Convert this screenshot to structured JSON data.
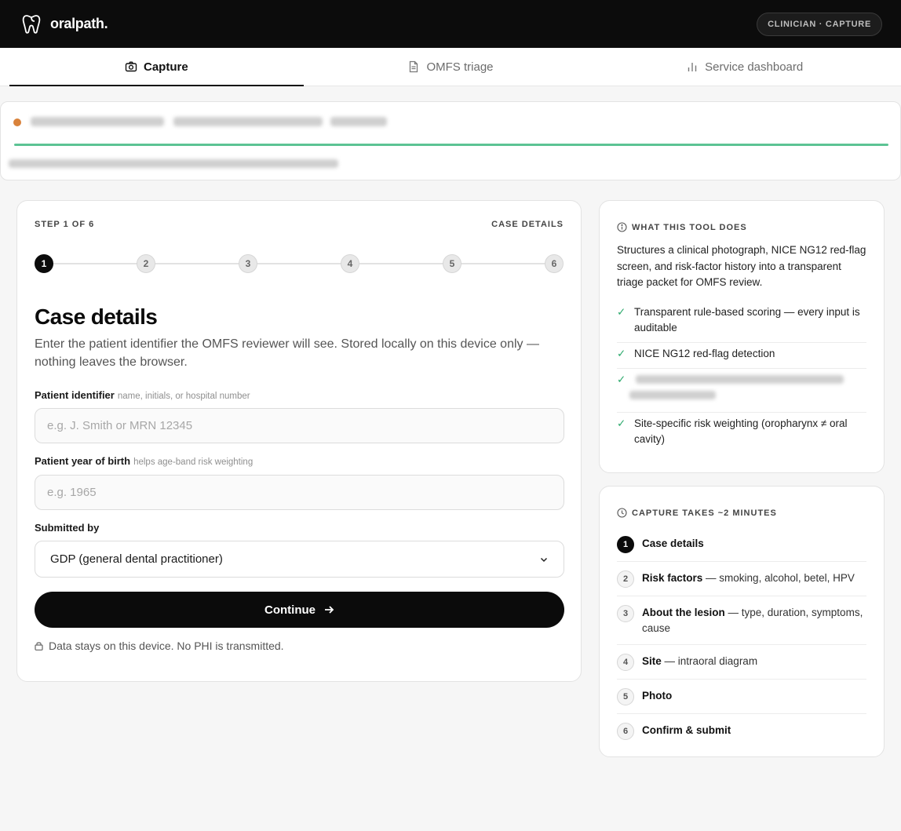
{
  "header": {
    "brand": "oralpath.",
    "mode_pill": "CLINICIAN · CAPTURE"
  },
  "tabs": [
    {
      "label": "Capture",
      "icon": "camera-icon",
      "active": true
    },
    {
      "label": "OMFS triage",
      "icon": "document-icon",
      "active": false
    },
    {
      "label": "Service dashboard",
      "icon": "bar-chart-icon",
      "active": false
    }
  ],
  "form": {
    "step_label": "STEP 1 OF 6",
    "section_label": "CASE DETAILS",
    "steps": [
      "1",
      "2",
      "3",
      "4",
      "5",
      "6"
    ],
    "active_step": 1,
    "title": "Case details",
    "lede": "Enter the patient identifier the OMFS reviewer will see. Stored locally on this device only — nothing leaves the browser.",
    "patient_id": {
      "label": "Patient identifier",
      "hint": "name, initials, or hospital number",
      "placeholder": "e.g. J. Smith or MRN 12345",
      "value": ""
    },
    "birth_year": {
      "label": "Patient year of birth",
      "hint": "helps age-band risk weighting",
      "placeholder": "e.g. 1965",
      "value": ""
    },
    "submitted_by": {
      "label": "Submitted by",
      "value": "GDP (general dental practitioner)"
    },
    "continue_label": "Continue",
    "footnote": "Data stays on this device. No PHI is transmitted."
  },
  "info": {
    "heading": "WHAT THIS TOOL DOES",
    "description": "Structures a clinical photograph, NICE NG12 red-flag screen, and risk-factor history into a transparent triage packet for OMFS review.",
    "points": [
      "Transparent rule-based scoring — every input is auditable",
      "NICE NG12 red-flag detection",
      "",
      "Site-specific risk weighting (oropharynx ≠ oral cavity)"
    ]
  },
  "timeline": {
    "heading": "CAPTURE TAKES ~2 MINUTES",
    "steps": [
      {
        "num": "1",
        "title": "Case details",
        "detail": ""
      },
      {
        "num": "2",
        "title": "Risk factors",
        "detail": " — smoking, alcohol, betel, HPV"
      },
      {
        "num": "3",
        "title": "About the lesion",
        "detail": " — type, duration, symptoms, cause"
      },
      {
        "num": "4",
        "title": "Site",
        "detail": " — intraoral diagram"
      },
      {
        "num": "5",
        "title": "Photo",
        "detail": ""
      },
      {
        "num": "6",
        "title": "Confirm & submit",
        "detail": ""
      }
    ]
  },
  "colors": {
    "accent": "#0b0b0b",
    "success": "#2eaa6e",
    "notice_bar": "#5cc394",
    "notice_dot": "#d9823b"
  }
}
